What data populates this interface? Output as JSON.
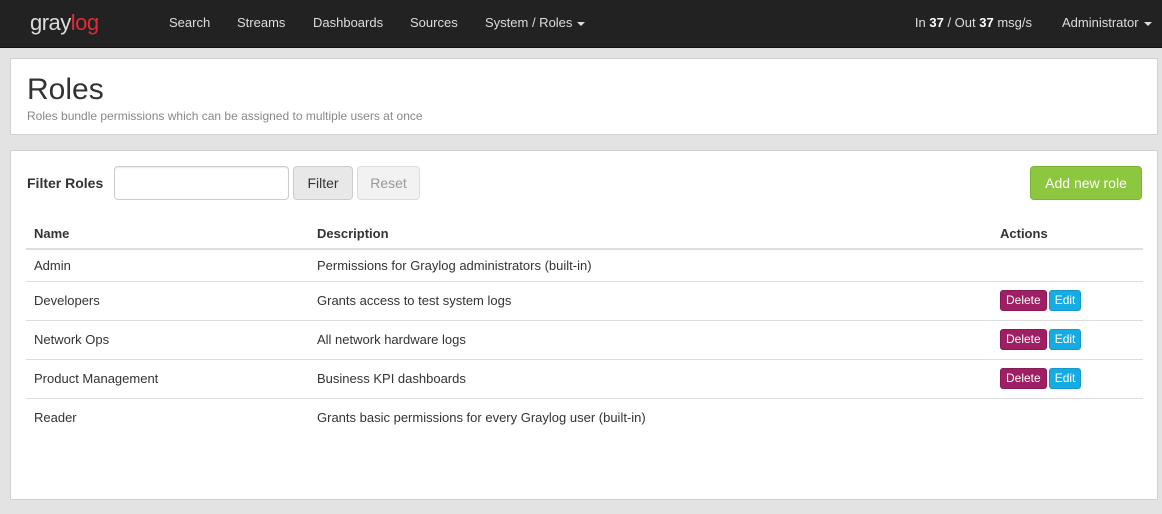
{
  "app": {
    "logo_part1": "gray",
    "logo_part2": "log"
  },
  "nav": {
    "items": [
      "Search",
      "Streams",
      "Dashboards",
      "Sources",
      "System / Roles"
    ],
    "throughput": {
      "in_prefix": "In ",
      "in_value": "37",
      "out_prefix": " / Out ",
      "out_value": "37",
      "suffix": " msg/s"
    },
    "user": "Administrator"
  },
  "header": {
    "title": "Roles",
    "description": "Roles bundle permissions which can be assigned to multiple users at once"
  },
  "filter": {
    "label": "Filter Roles",
    "value": "",
    "filter_button": "Filter",
    "reset_button": "Reset"
  },
  "add_button": "Add new role",
  "table": {
    "columns": [
      "Name",
      "Description",
      "Actions"
    ],
    "rows": [
      {
        "name": "Admin",
        "description": "Permissions for Graylog administrators (built-in)",
        "actions": []
      },
      {
        "name": "Developers",
        "description": "Grants access to test system logs",
        "actions": [
          "Delete",
          "Edit"
        ]
      },
      {
        "name": "Network Ops",
        "description": "All network hardware logs",
        "actions": [
          "Delete",
          "Edit"
        ]
      },
      {
        "name": "Product Management",
        "description": "Business KPI dashboards",
        "actions": [
          "Delete",
          "Edit"
        ]
      },
      {
        "name": "Reader",
        "description": "Grants basic permissions for every Graylog user (built-in)",
        "actions": []
      }
    ]
  },
  "colors": {
    "navbar": "#222222",
    "brand_red": "#e02c38",
    "add_button": "#8dc63f",
    "delete_button": "#9e1f63",
    "edit_button": "#16ace3"
  }
}
